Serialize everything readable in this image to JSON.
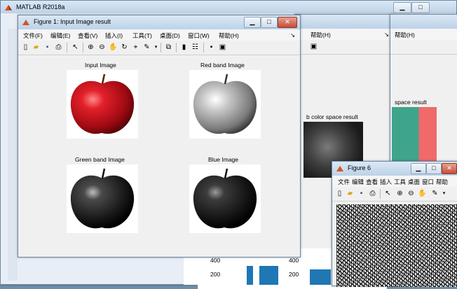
{
  "matlab": {
    "title": "MATLAB R2018a"
  },
  "figure1": {
    "title": "Figure 1: Input Image result",
    "menu": [
      "文件(F)",
      "编辑(E)",
      "查看(V)",
      "插入(I)",
      "工具(T)",
      "桌面(D)",
      "窗口(W)",
      "帮助(H)"
    ],
    "panels": {
      "input": "Input Image",
      "red": "Red band Image",
      "green": "Green band Image",
      "blue": "Blue Image"
    }
  },
  "figure2": {
    "menu_help": "帮助(H)"
  },
  "figure3": {
    "menu_help": "帮助(H)",
    "title": "space result"
  },
  "figure4": {
    "title": "b color space result"
  },
  "figure6": {
    "title": "Figure 6",
    "menu": [
      "文件",
      "编辑",
      "查看",
      "插入",
      "工具",
      "桌面",
      "窗口",
      "帮助"
    ]
  },
  "histogram": {
    "ticks": [
      "400",
      "200",
      "400",
      "200"
    ]
  },
  "colors": {
    "titlebar": "#bcd2e8",
    "apple_red": "#c0101a",
    "overlay_red": "#f06a6a",
    "overlay_teal": "#3fa58a"
  }
}
